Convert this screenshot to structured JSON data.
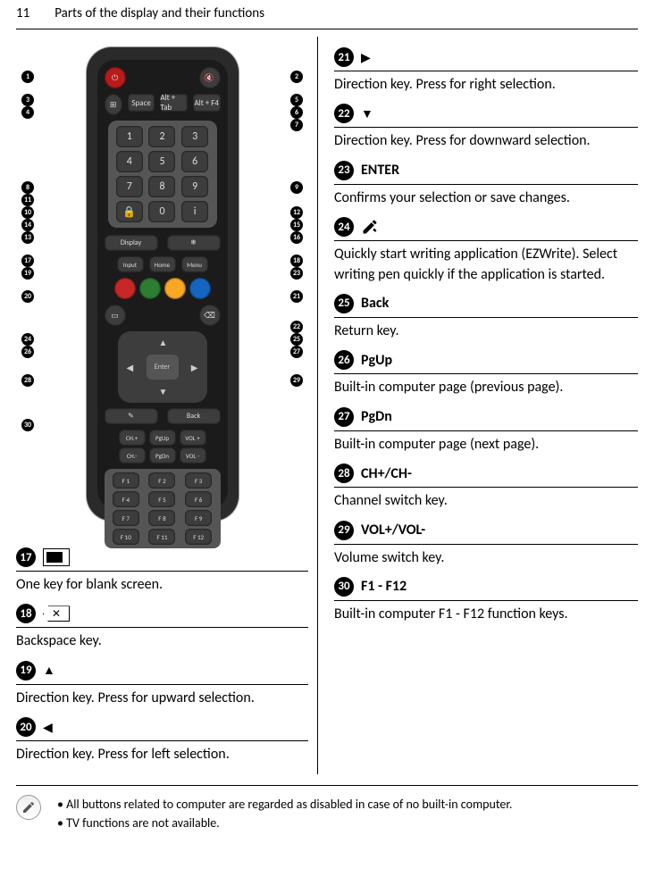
{
  "page": {
    "number": "11",
    "title": "Parts of the display and their functions"
  },
  "remote": {
    "btn_space": "Space",
    "btn_alt_tab": "Alt + Tab",
    "btn_alt_f4": "Alt + F4",
    "keypad": [
      "1",
      "2",
      "3",
      "4",
      "5",
      "6",
      "7",
      "8",
      "9",
      "0"
    ],
    "btn_display": "Display",
    "btn_input": "Input",
    "btn_home": "Home",
    "btn_menu": "Menu",
    "enter": "Enter",
    "btn_back": "Back",
    "btn_ch_plus": "CH.+",
    "btn_ch_minus": "CH.-",
    "btn_pgup": "PgUp",
    "btn_pgdn": "PgDn",
    "btn_vol_plus": "VOL +",
    "btn_vol_minus": "VOL -",
    "fkeys": [
      "F 1",
      "F 2",
      "F 3",
      "F 4",
      "F 5",
      "F 6",
      "F 7",
      "F 8",
      "F 9",
      "F 10",
      "F 11",
      "F 12"
    ]
  },
  "left_items": [
    {
      "num": "17",
      "icon": "screen",
      "desc": "One key for blank screen."
    },
    {
      "num": "18",
      "icon": "backspace",
      "desc": "Backspace key."
    },
    {
      "num": "19",
      "icon": "▲",
      "desc": "Direction key. Press for upward selection."
    },
    {
      "num": "20",
      "icon": "◀",
      "desc": "Direction key. Press for left selection."
    }
  ],
  "right_items": [
    {
      "num": "21",
      "icon": "▶",
      "desc": "Direction key. Press for right selection."
    },
    {
      "num": "22",
      "icon": "▼",
      "desc": "Direction key. Press for downward selection."
    },
    {
      "num": "23",
      "title": "ENTER",
      "desc": "Confirms your selection or save changes."
    },
    {
      "num": "24",
      "icon": "pen",
      "desc": "Quickly start writing application (EZWrite). Select writing pen quickly if the application is started."
    },
    {
      "num": "25",
      "title": "Back",
      "desc": "Return key."
    },
    {
      "num": "26",
      "title": "PgUp",
      "desc": "Built-in computer page (previous page)."
    },
    {
      "num": "27",
      "title": "PgDn",
      "desc": "Built-in computer page (next page)."
    },
    {
      "num": "28",
      "title": "CH+/CH-",
      "desc": "Channel switch key."
    },
    {
      "num": "29",
      "title": "VOL+/VOL-",
      "desc": "Volume switch key."
    },
    {
      "num": "30",
      "title": "F1 - F12",
      "desc": "Built-in computer F1 - F12 function keys."
    }
  ],
  "footnote": {
    "line1": "• All buttons related to computer are regarded as disabled in case of no built-in computer.",
    "line2": "• TV functions are not available."
  },
  "callouts_left": [
    "1",
    "3",
    "4",
    "8",
    "11",
    "10",
    "14",
    "13",
    "17",
    "19",
    "20",
    "24",
    "26",
    "28",
    "30"
  ],
  "callouts_right": [
    "2",
    "5",
    "6",
    "7",
    "9",
    "12",
    "15",
    "16",
    "18",
    "23",
    "21",
    "22",
    "25",
    "27",
    "29"
  ]
}
